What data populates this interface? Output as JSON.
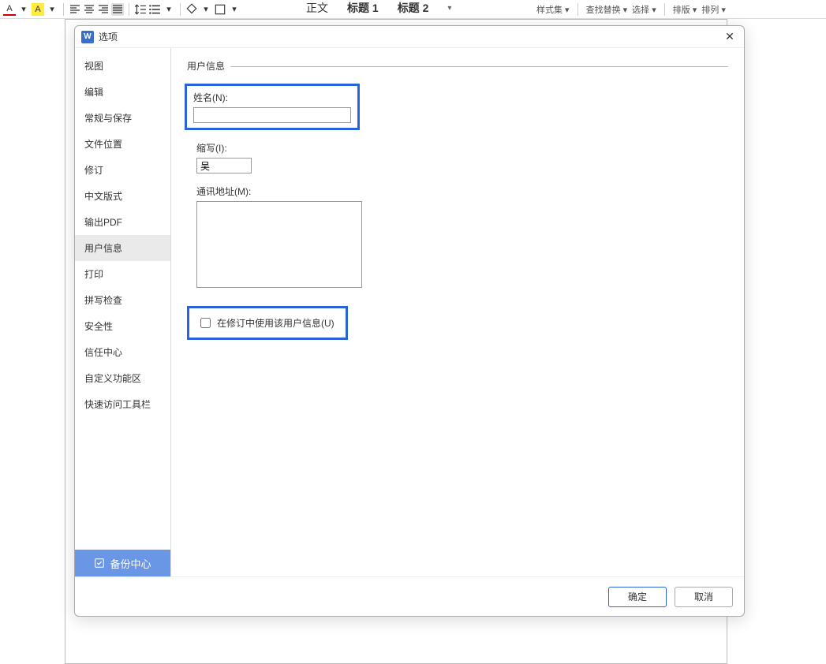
{
  "ribbon": {
    "styles": [
      "正文",
      "标题 1",
      "标题 2"
    ],
    "right_items": [
      "样式集 ▾",
      "查找替换 ▾",
      "选择 ▾",
      "排版 ▾",
      "排列 ▾"
    ]
  },
  "dialog": {
    "title": "选项",
    "close_glyph": "✕",
    "ok_label": "确定",
    "cancel_label": "取消"
  },
  "sidebar": {
    "items": [
      "视图",
      "编辑",
      "常规与保存",
      "文件位置",
      "修订",
      "中文版式",
      "输出PDF",
      "用户信息",
      "打印",
      "拼写检查",
      "安全性",
      "信任中心",
      "自定义功能区",
      "快速访问工具栏"
    ],
    "active_index": 7,
    "backup_label": "备份中心"
  },
  "content": {
    "section_title": "用户信息",
    "name_label": "姓名(N):",
    "name_value": "",
    "initials_label": "缩写(I):",
    "initials_value": "吴",
    "address_label": "通讯地址(M):",
    "address_value": "",
    "use_in_revision_label": "在修订中使用该用户信息(U)"
  }
}
